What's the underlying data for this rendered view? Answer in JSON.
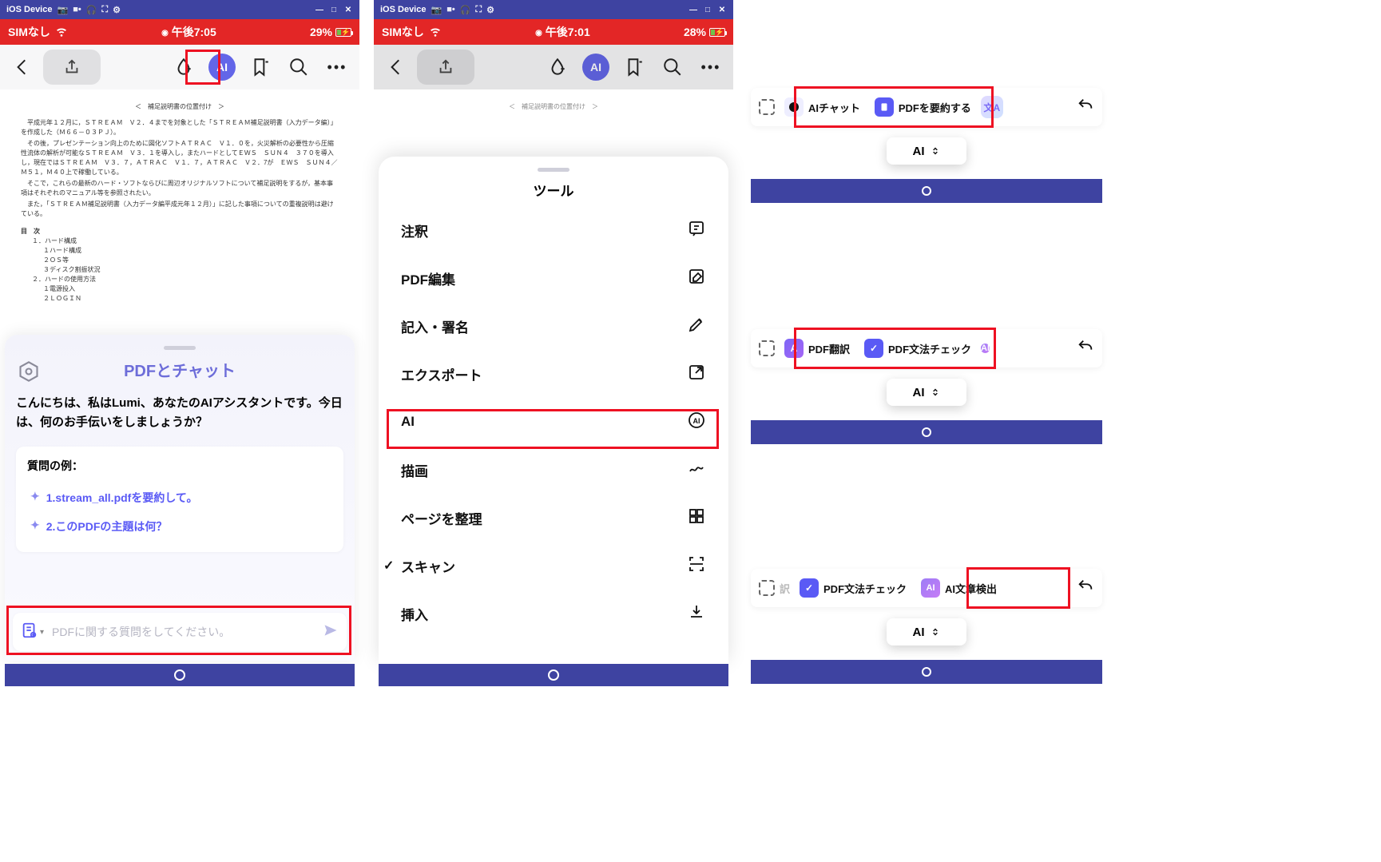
{
  "titlebar": {
    "device": "iOS Device"
  },
  "status1": {
    "sim": "SIMなし",
    "time": "午後7:05",
    "battery": "29%"
  },
  "status2": {
    "sim": "SIMなし",
    "time": "午後7:01",
    "battery": "28%"
  },
  "toolbar": {
    "ai": "AI"
  },
  "pdf": {
    "heading": "＜　補足説明書の位置付け　＞",
    "para1": "平成元年１２月に，ＳＴＲＥＡＭ　Ｖ２．４までを対象とした「ＳＴＲＥＡＭ補足説明書（入力データ編）」を作成した（Ｍ６６－０３ＰＪ）。",
    "para2": "その後，プレゼンテーション向上のために図化ソフトＡＴＲＡＣ　Ｖ１．０を，火災解析の必要性から圧縮性流体の解析が可能なＳＴＲＥＡＭ　Ｖ３．１を導入し，またハードとしてＥＷＳ　ＳＵＮ４　３７０を導入し，現在ではＳＴＲＥＡＭ　Ｖ３．７，ＡＴＲＡＣ　Ｖ１．７，ＡＴＲＡＣ　Ｖ２．7が　ＥＷＳ　ＳＵＮ４／Ｍ５１，Ｍ４０上で稼働している。",
    "para3": "そこで，これらの最新のハード・ソフトならびに周辺オリジナルソフトについて補足説明をするが，基本事項はそれぞれのマニュアル等を参照されたい。",
    "para4": "また，「ＳＴＲＥＡＭ補足説明書（入力データ編平成元年１２月）」に記した事項についての重複説明は避けている。",
    "toc_title": "目　次",
    "toc": [
      "１．ハード構成",
      "１ハード構成",
      "２ＯＳ等",
      "３ディスク割振状況",
      "２．ハードの使用方法",
      "１電源投入",
      "２ＬＯＧＩＮ"
    ]
  },
  "chat": {
    "title": "PDFとチャット",
    "greeting": "こんにちは、私はLumi、あなたのAIアシスタントです。今日は、何のお手伝いをしましょうか？",
    "examples_label": "質問の例：",
    "ex1": "1.stream_all.pdfを要約して。",
    "ex2": "2.このPDFの主題は何？",
    "placeholder": "PDFに関する質問をしてください。"
  },
  "tools": {
    "title": "ツール",
    "items": [
      "注釈",
      "PDF編集",
      "記入・署名",
      "エクスポート",
      "AI",
      "描画",
      "ページを整理",
      "スキャン",
      "挿入"
    ]
  },
  "mini1": {
    "chat": "AIチャット",
    "summarize": "PDFを要約する",
    "ai": "AI"
  },
  "mini2": {
    "translate": "PDF翻訳",
    "grammar": "PDF文法チェック",
    "ai": "AI"
  },
  "mini3": {
    "grammar": "PDF文法チェック",
    "detect": "AI文章検出",
    "ai": "AI"
  }
}
